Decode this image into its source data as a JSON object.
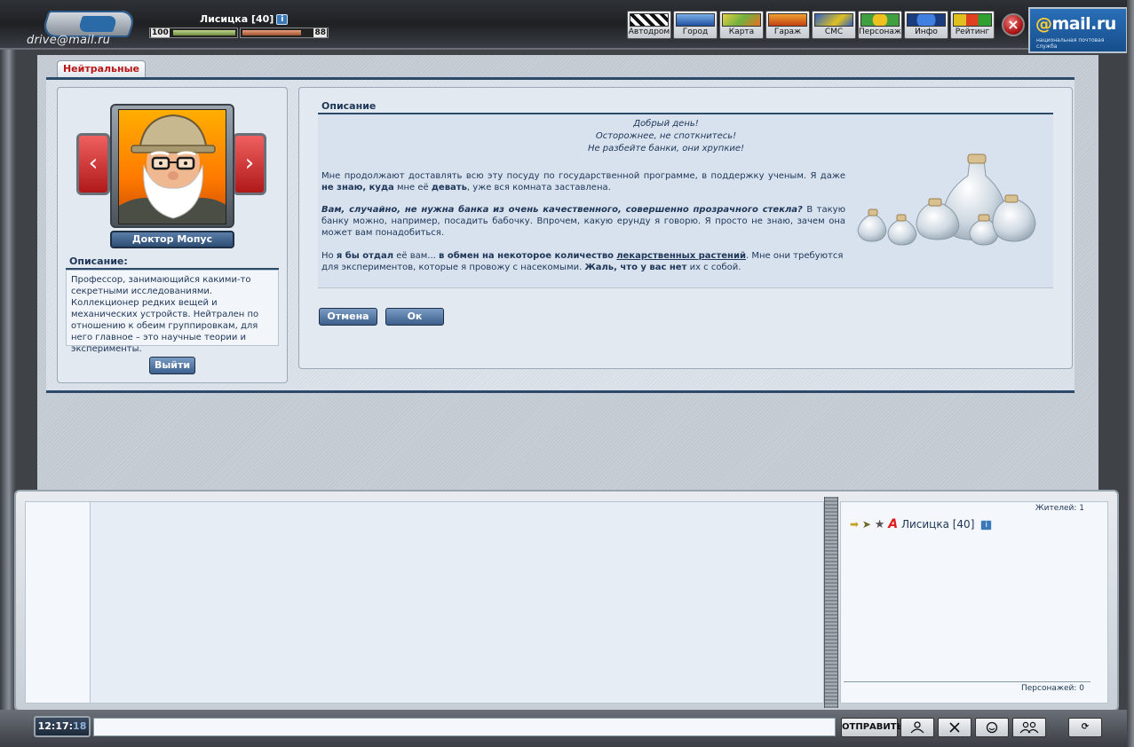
{
  "header": {
    "logo_text": "drive@mail.ru",
    "player": {
      "name": "Лисицка [40]",
      "help_icon": "i"
    },
    "hp_label": "100",
    "energy_label": "88",
    "nav": [
      {
        "label": "Автодром",
        "icon": "race-flags-icon"
      },
      {
        "label": "Город",
        "icon": "city-icon"
      },
      {
        "label": "Карта",
        "icon": "map-icon"
      },
      {
        "label": "Гараж",
        "icon": "garage-icon"
      },
      {
        "label": "СМС",
        "icon": "sms-icon"
      },
      {
        "label": "Персонаж",
        "icon": "character-icon"
      },
      {
        "label": "Инфо",
        "icon": "info-icon"
      },
      {
        "label": "Рейтинг",
        "icon": "rating-icon"
      }
    ],
    "close_icon": "×",
    "brand": {
      "at": "@",
      "name": "mail.ru",
      "tagline": "национальная почтовая служба"
    }
  },
  "tab": {
    "label": "Нейтральные"
  },
  "npc": {
    "prev_icon": "‹",
    "next_icon": "›",
    "name": "Доктор Мопус",
    "desc_title": "Описание:",
    "desc_text": "Профессор, занимающийся какими-то секретными исследованиями. Коллекционер редких вещей и механических устройств. Нейтрален по отношению к обеим группировкам, для него главное – это научные теории и эксперименты.",
    "exit_label": "Выйти"
  },
  "dialog": {
    "title": "Описание",
    "greeting": [
      "Добрый день!",
      "Осторожнее, не споткнитесь!",
      "Не разбейте банки, они хрупкие!"
    ],
    "p1": {
      "a": "Мне продолжают доставлять всю эту посуду по государственной программе, в поддержку ученым. Я даже ",
      "b": "не знаю, куда",
      "c": " мне её ",
      "d": "девать",
      "e": ", уже вся комната заставлена."
    },
    "p2": {
      "a": "Вам, случайно, не нужна банка из очень качественного, совершенно прозрачного стекла?",
      "b": " В такую банку можно, например, посадить бабочку. Впрочем, какую ерунду я говорю. Я просто не знаю, зачем она может вам понадобиться."
    },
    "p3": {
      "a": "Но ",
      "b": "я бы отдал",
      "c": " её вам... ",
      "d": "в обмен на некоторое количество",
      "e": " ",
      "link": "лекарственных растений",
      "f": ". Мне они требуются",
      "g": "для экспериментов, которые я провожу с насекомыми. ",
      "h": "Жаль, что у вас нет",
      "i": " их с собой."
    },
    "cancel_label": "Отмена",
    "ok_label": "Ок"
  },
  "users": {
    "residents": "Жителей: 1",
    "list": [
      {
        "name": "Лисицка [40]",
        "icon_letter": "A"
      }
    ],
    "characters": "Персонажей: 0"
  },
  "bottom": {
    "clock_hm": "12:17:",
    "clock_s": "18",
    "send_label": "ОТПРАВИТЬ",
    "refresh_icon": "⟳"
  }
}
